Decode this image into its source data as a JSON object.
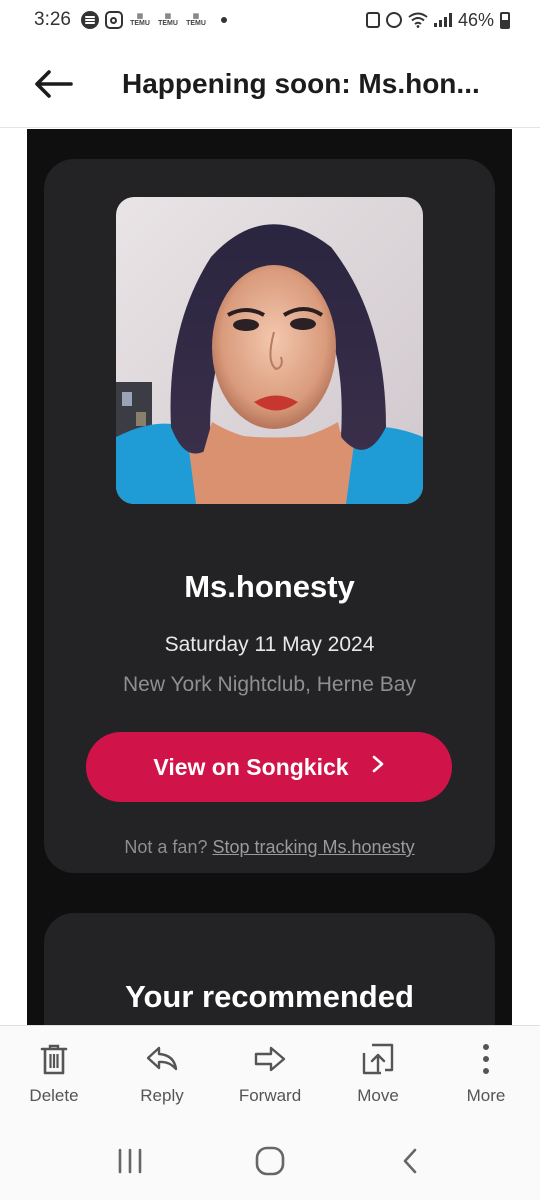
{
  "status_bar": {
    "time": "3:26",
    "temu_label": "TEMU",
    "battery": "46%"
  },
  "app_bar": {
    "title": "Happening soon: Ms.hon..."
  },
  "event_card": {
    "artist": "Ms.honesty",
    "date": "Saturday 11 May 2024",
    "venue": "New York Nightclub, Herne Bay",
    "cta_label": "View on Songkick",
    "unsub_prefix": "Not a fan?",
    "unsub_link": "Stop tracking Ms.honesty"
  },
  "recommended": {
    "title": "Your recommended"
  },
  "actions": {
    "delete": "Delete",
    "reply": "Reply",
    "forward": "Forward",
    "move": "Move",
    "more": "More"
  },
  "colors": {
    "cta": "#d01348",
    "content_bg": "#0f0f0f",
    "card_bg": "#232325"
  }
}
